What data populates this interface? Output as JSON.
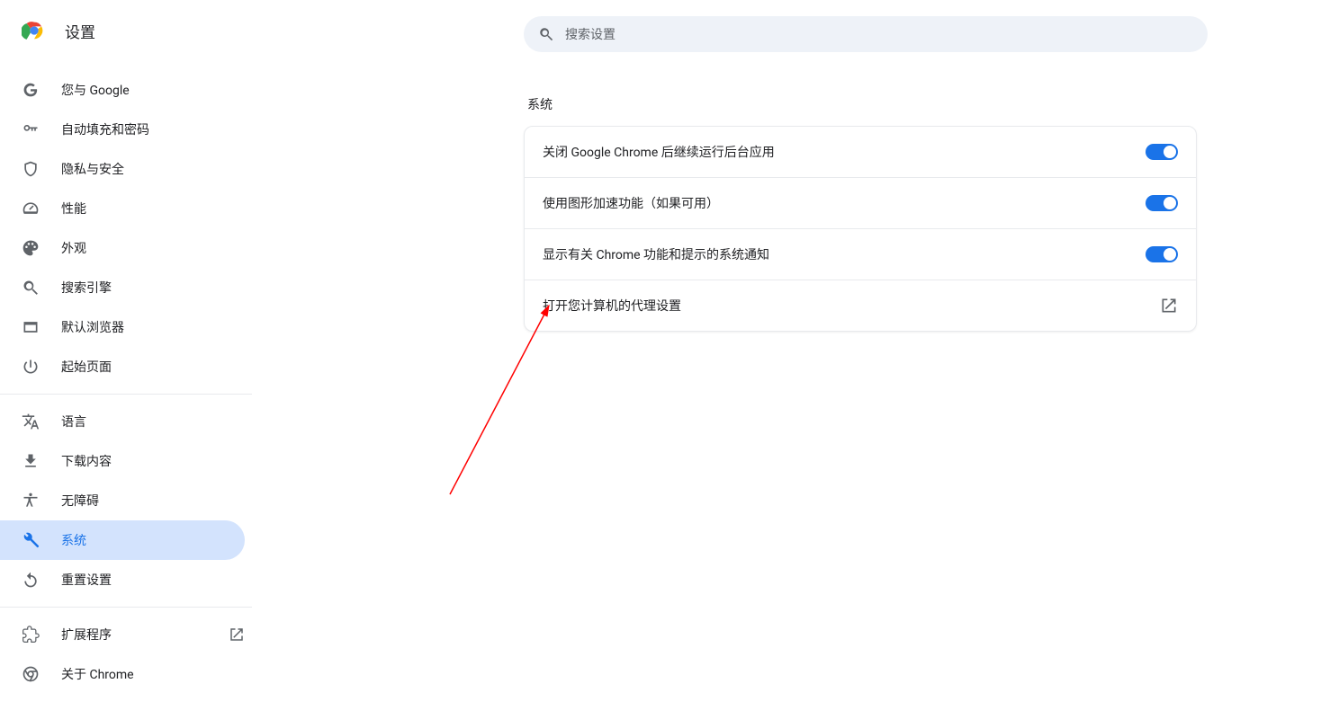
{
  "header": {
    "title": "设置"
  },
  "search": {
    "placeholder": "搜索设置"
  },
  "sidebar": {
    "group1": [
      {
        "label": "您与 Google"
      },
      {
        "label": "自动填充和密码"
      },
      {
        "label": "隐私与安全"
      },
      {
        "label": "性能"
      },
      {
        "label": "外观"
      },
      {
        "label": "搜索引擎"
      },
      {
        "label": "默认浏览器"
      },
      {
        "label": "起始页面"
      }
    ],
    "group2": [
      {
        "label": "语言"
      },
      {
        "label": "下载内容"
      },
      {
        "label": "无障碍"
      },
      {
        "label": "系统"
      },
      {
        "label": "重置设置"
      }
    ],
    "group3": [
      {
        "label": "扩展程序"
      },
      {
        "label": "关于 Chrome"
      }
    ]
  },
  "section": {
    "title": "系统",
    "rows": [
      {
        "label": "关闭 Google Chrome 后继续运行后台应用"
      },
      {
        "label": "使用图形加速功能（如果可用）"
      },
      {
        "label": "显示有关 Chrome 功能和提示的系统通知"
      },
      {
        "label": "打开您计算机的代理设置"
      }
    ]
  }
}
